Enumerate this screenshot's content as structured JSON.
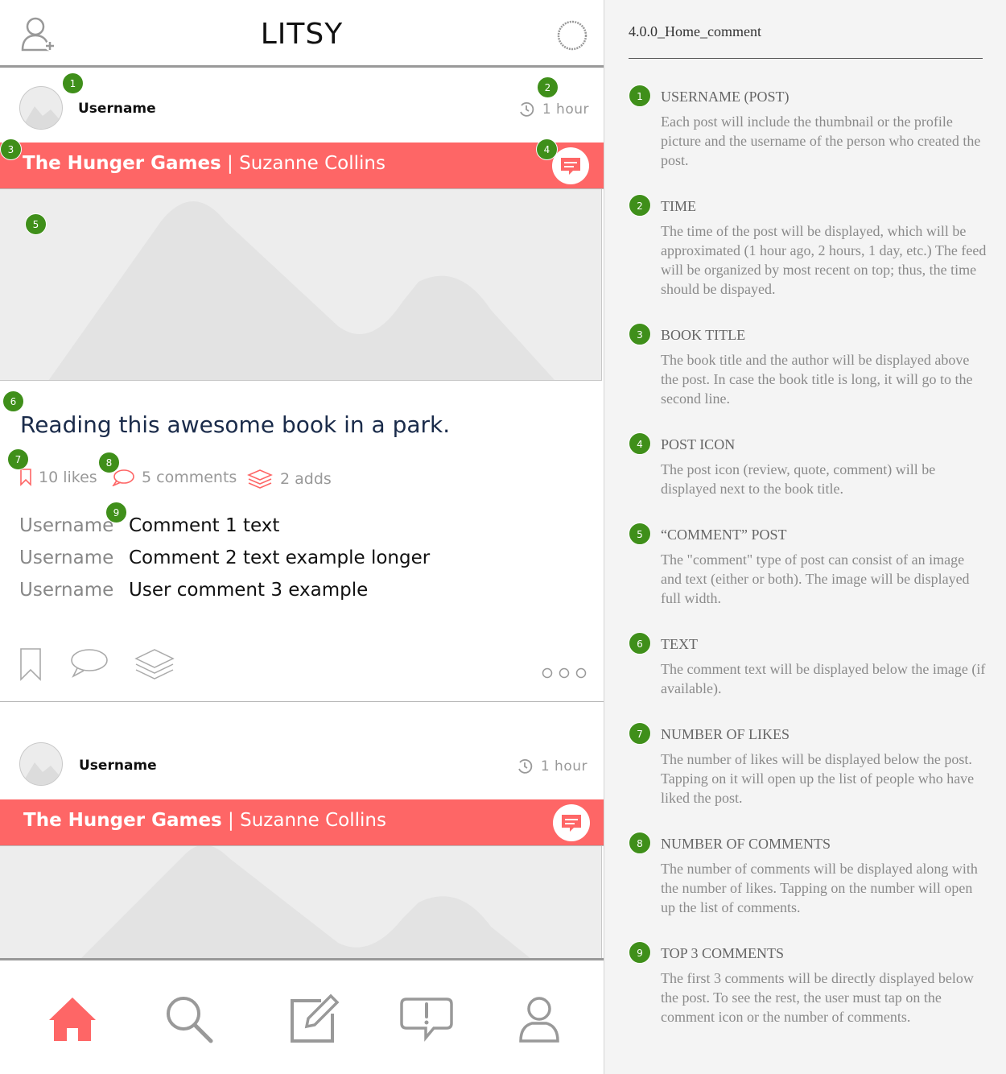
{
  "app": {
    "title": "LITSY"
  },
  "posts": [
    {
      "username": "Username",
      "time": "1 hour",
      "book_title": "The Hunger Games",
      "separator": "|",
      "author": "Suzanne Collins",
      "text": "Reading this awesome book in a park.",
      "stats": {
        "likes": "10 likes",
        "comments": "5 comments",
        "adds": "2 adds"
      },
      "comments": [
        {
          "user": "Username",
          "text": "Comment 1 text"
        },
        {
          "user": "Username",
          "text": "Comment 2 text example longer"
        },
        {
          "user": "Username",
          "text": "User comment 3 example"
        }
      ]
    },
    {
      "username": "Username",
      "time": "1 hour",
      "book_title": "The Hunger Games",
      "separator": "|",
      "author": "Suzanne Collins"
    }
  ],
  "tabs": [
    {
      "name": "home",
      "icon": "home-icon",
      "active": true
    },
    {
      "name": "search",
      "icon": "search-icon",
      "active": false
    },
    {
      "name": "compose",
      "icon": "edit-icon",
      "active": false
    },
    {
      "name": "notifications",
      "icon": "alert-bubble-icon",
      "active": false
    },
    {
      "name": "profile",
      "icon": "user-icon",
      "active": false
    }
  ],
  "markers": [
    "1",
    "2",
    "3",
    "4",
    "5",
    "6",
    "7",
    "8",
    "9"
  ],
  "colors": {
    "accent": "#fe6666",
    "marker": "#3f8f1a",
    "notes_bg": "#f4f4f4"
  },
  "notes": {
    "screen_id": "4.0.0_Home_comment",
    "items": [
      {
        "num": "1",
        "title": "USERNAME (POST)",
        "body": "Each post will include the thumbnail or the profile picture and the username of the person who created the post."
      },
      {
        "num": "2",
        "title": "TIME",
        "body": "The time of the post will be displayed, which will be approximated (1 hour ago, 2 hours, 1 day, etc.) The feed will be organized by most recent on top; thus, the time should be dispayed."
      },
      {
        "num": "3",
        "title": "BOOK TITLE",
        "body": "The book title and the author will be displayed above the post. In case the book title is long, it will go to the second line."
      },
      {
        "num": "4",
        "title": "POST ICON",
        "body": "The post icon (review, quote, comment) will be displayed next to the book title."
      },
      {
        "num": "5",
        "title": "“COMMENT”  POST",
        "body": "The \"comment\" type of post can consist of an image and text (either or both). The image will be displayed full width."
      },
      {
        "num": "6",
        "title": "TEXT",
        "body": "The comment text will be displayed below the image (if available)."
      },
      {
        "num": "7",
        "title": "NUMBER OF LIKES",
        "body": "The number of likes will be displayed below the post. Tapping on it will open up the list of people who have liked the post."
      },
      {
        "num": "8",
        "title": "NUMBER OF COMMENTS",
        "body": "The number of comments will be displayed along with the number of likes. Tapping on the number will open up the list of comments."
      },
      {
        "num": "9",
        "title": "TOP 3 COMMENTS",
        "body": "The first 3 comments will be directly displayed below the post. To see the rest, the user must tap on the comment icon or the number of comments."
      }
    ]
  }
}
